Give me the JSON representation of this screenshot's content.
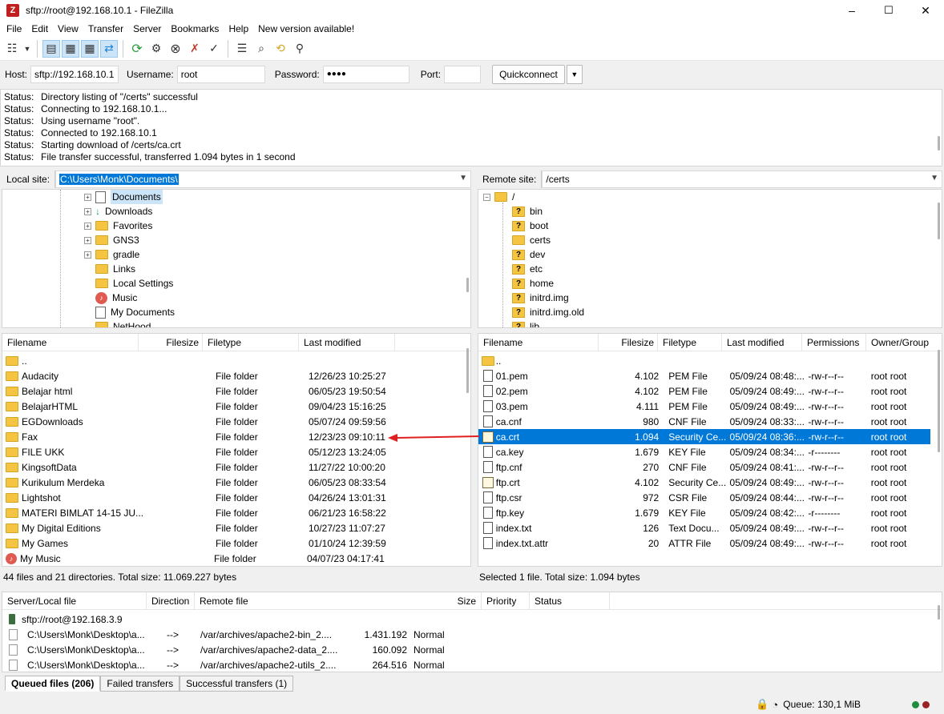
{
  "window": {
    "title": "sftp://root@192.168.10.1 - FileZilla",
    "minimize": "–",
    "maximize": "☐",
    "close": "✕"
  },
  "menu": [
    "File",
    "Edit",
    "View",
    "Transfer",
    "Server",
    "Bookmarks",
    "Help",
    "New version available!"
  ],
  "quickconnect": {
    "host_label": "Host:",
    "host_value": "sftp://192.168.10.1",
    "username_label": "Username:",
    "username_value": "root",
    "password_label": "Password:",
    "password_value": "●●●●",
    "port_label": "Port:",
    "port_value": "",
    "button": "Quickconnect"
  },
  "log": [
    {
      "label": "Status:",
      "text": "Directory listing of \"/certs\" successful"
    },
    {
      "label": "Status:",
      "text": "Connecting to 192.168.10.1..."
    },
    {
      "label": "Status:",
      "text": "Using username \"root\"."
    },
    {
      "label": "Status:",
      "text": "Connected to 192.168.10.1"
    },
    {
      "label": "Status:",
      "text": "Starting download of /certs/ca.crt"
    },
    {
      "label": "Status:",
      "text": "File transfer successful, transferred 1.094 bytes in 1 second"
    }
  ],
  "local": {
    "site_label": "Local site:",
    "path": "C:\\Users\\Monk\\Documents\\",
    "tree": [
      "Documents",
      "Downloads",
      "Favorites",
      "GNS3",
      "gradle",
      "Links",
      "Local Settings",
      "Music",
      "My Documents",
      "NetHood"
    ],
    "columns": [
      "Filename",
      "Filesize",
      "Filetype",
      "Last modified"
    ],
    "files": [
      {
        "name": "..",
        "size": "",
        "type": "",
        "modified": ""
      },
      {
        "name": "Audacity",
        "size": "",
        "type": "File folder",
        "modified": "12/26/23 10:25:27"
      },
      {
        "name": "Belajar html",
        "size": "",
        "type": "File folder",
        "modified": "06/05/23 19:50:54"
      },
      {
        "name": "BelajarHTML",
        "size": "",
        "type": "File folder",
        "modified": "09/04/23 15:16:25"
      },
      {
        "name": "EGDownloads",
        "size": "",
        "type": "File folder",
        "modified": "05/07/24 09:59:56"
      },
      {
        "name": "Fax",
        "size": "",
        "type": "File folder",
        "modified": "12/23/23 09:10:11"
      },
      {
        "name": "FILE UKK",
        "size": "",
        "type": "File folder",
        "modified": "05/12/23 13:24:05"
      },
      {
        "name": "KingsoftData",
        "size": "",
        "type": "File folder",
        "modified": "11/27/22 10:00:20"
      },
      {
        "name": "Kurikulum Merdeka",
        "size": "",
        "type": "File folder",
        "modified": "06/05/23 08:33:54"
      },
      {
        "name": "Lightshot",
        "size": "",
        "type": "File folder",
        "modified": "04/26/24 13:01:31"
      },
      {
        "name": "MATERI BIMLAT 14-15 JU...",
        "size": "",
        "type": "File folder",
        "modified": "06/21/23 16:58:22"
      },
      {
        "name": "My Digital Editions",
        "size": "",
        "type": "File folder",
        "modified": "10/27/23 11:07:27"
      },
      {
        "name": "My Games",
        "size": "",
        "type": "File folder",
        "modified": "01/10/24 12:39:59"
      },
      {
        "name": "My Music",
        "size": "",
        "type": "File folder",
        "modified": "04/07/23 04:17:41"
      }
    ],
    "status": "44 files and 21 directories. Total size: 11.069.227 bytes"
  },
  "remote": {
    "site_label": "Remote site:",
    "path": "/certs",
    "tree_root": "/",
    "tree": [
      "bin",
      "boot",
      "certs",
      "dev",
      "etc",
      "home",
      "initrd.img",
      "initrd.img.old",
      "lib"
    ],
    "columns": [
      "Filename",
      "Filesize",
      "Filetype",
      "Last modified",
      "Permissions",
      "Owner/Group"
    ],
    "files": [
      {
        "name": "..",
        "size": "",
        "type": "",
        "modified": "",
        "perm": "",
        "owner": ""
      },
      {
        "name": "01.pem",
        "size": "4.102",
        "type": "PEM File",
        "modified": "05/09/24 08:48:...",
        "perm": "-rw-r--r--",
        "owner": "root root"
      },
      {
        "name": "02.pem",
        "size": "4.102",
        "type": "PEM File",
        "modified": "05/09/24 08:49:...",
        "perm": "-rw-r--r--",
        "owner": "root root"
      },
      {
        "name": "03.pem",
        "size": "4.111",
        "type": "PEM File",
        "modified": "05/09/24 08:49:...",
        "perm": "-rw-r--r--",
        "owner": "root root"
      },
      {
        "name": "ca.cnf",
        "size": "980",
        "type": "CNF File",
        "modified": "05/09/24 08:33:...",
        "perm": "-rw-r--r--",
        "owner": "root root"
      },
      {
        "name": "ca.crt",
        "size": "1.094",
        "type": "Security Ce...",
        "modified": "05/09/24 08:36:...",
        "perm": "-rw-r--r--",
        "owner": "root root",
        "selected": true
      },
      {
        "name": "ca.key",
        "size": "1.679",
        "type": "KEY File",
        "modified": "05/09/24 08:34:...",
        "perm": "-r--------",
        "owner": "root root"
      },
      {
        "name": "ftp.cnf",
        "size": "270",
        "type": "CNF File",
        "modified": "05/09/24 08:41:...",
        "perm": "-rw-r--r--",
        "owner": "root root"
      },
      {
        "name": "ftp.crt",
        "size": "4.102",
        "type": "Security Ce...",
        "modified": "05/09/24 08:49:...",
        "perm": "-rw-r--r--",
        "owner": "root root"
      },
      {
        "name": "ftp.csr",
        "size": "972",
        "type": "CSR File",
        "modified": "05/09/24 08:44:...",
        "perm": "-rw-r--r--",
        "owner": "root root"
      },
      {
        "name": "ftp.key",
        "size": "1.679",
        "type": "KEY File",
        "modified": "05/09/24 08:42:...",
        "perm": "-r--------",
        "owner": "root root"
      },
      {
        "name": "index.txt",
        "size": "126",
        "type": "Text Docu...",
        "modified": "05/09/24 08:49:...",
        "perm": "-rw-r--r--",
        "owner": "root root"
      },
      {
        "name": "index.txt.attr",
        "size": "20",
        "type": "ATTR File",
        "modified": "05/09/24 08:49:...",
        "perm": "-rw-r--r--",
        "owner": "root root"
      }
    ],
    "status": "Selected 1 file. Total size: 1.094 bytes"
  },
  "queue": {
    "columns": [
      "Server/Local file",
      "Direction",
      "Remote file",
      "Size",
      "Priority",
      "Status"
    ],
    "server": "sftp://root@192.168.3.9",
    "rows": [
      {
        "local": "C:\\Users\\Monk\\Desktop\\a...",
        "dir": "-->",
        "remote": "/var/archives/apache2-bin_2....",
        "size": "1.431.192",
        "priority": "Normal"
      },
      {
        "local": "C:\\Users\\Monk\\Desktop\\a...",
        "dir": "-->",
        "remote": "/var/archives/apache2-data_2....",
        "size": "160.092",
        "priority": "Normal"
      },
      {
        "local": "C:\\Users\\Monk\\Desktop\\a...",
        "dir": "-->",
        "remote": "/var/archives/apache2-utils_2....",
        "size": "264.516",
        "priority": "Normal"
      }
    ],
    "tabs": [
      "Queued files (206)",
      "Failed transfers",
      "Successful transfers (1)"
    ]
  },
  "statusbar": {
    "queue": "Queue: 130,1 MiB"
  },
  "colors": {
    "selection": "#0078d7",
    "arrow": "#e02020",
    "folder": "#f5c542"
  }
}
